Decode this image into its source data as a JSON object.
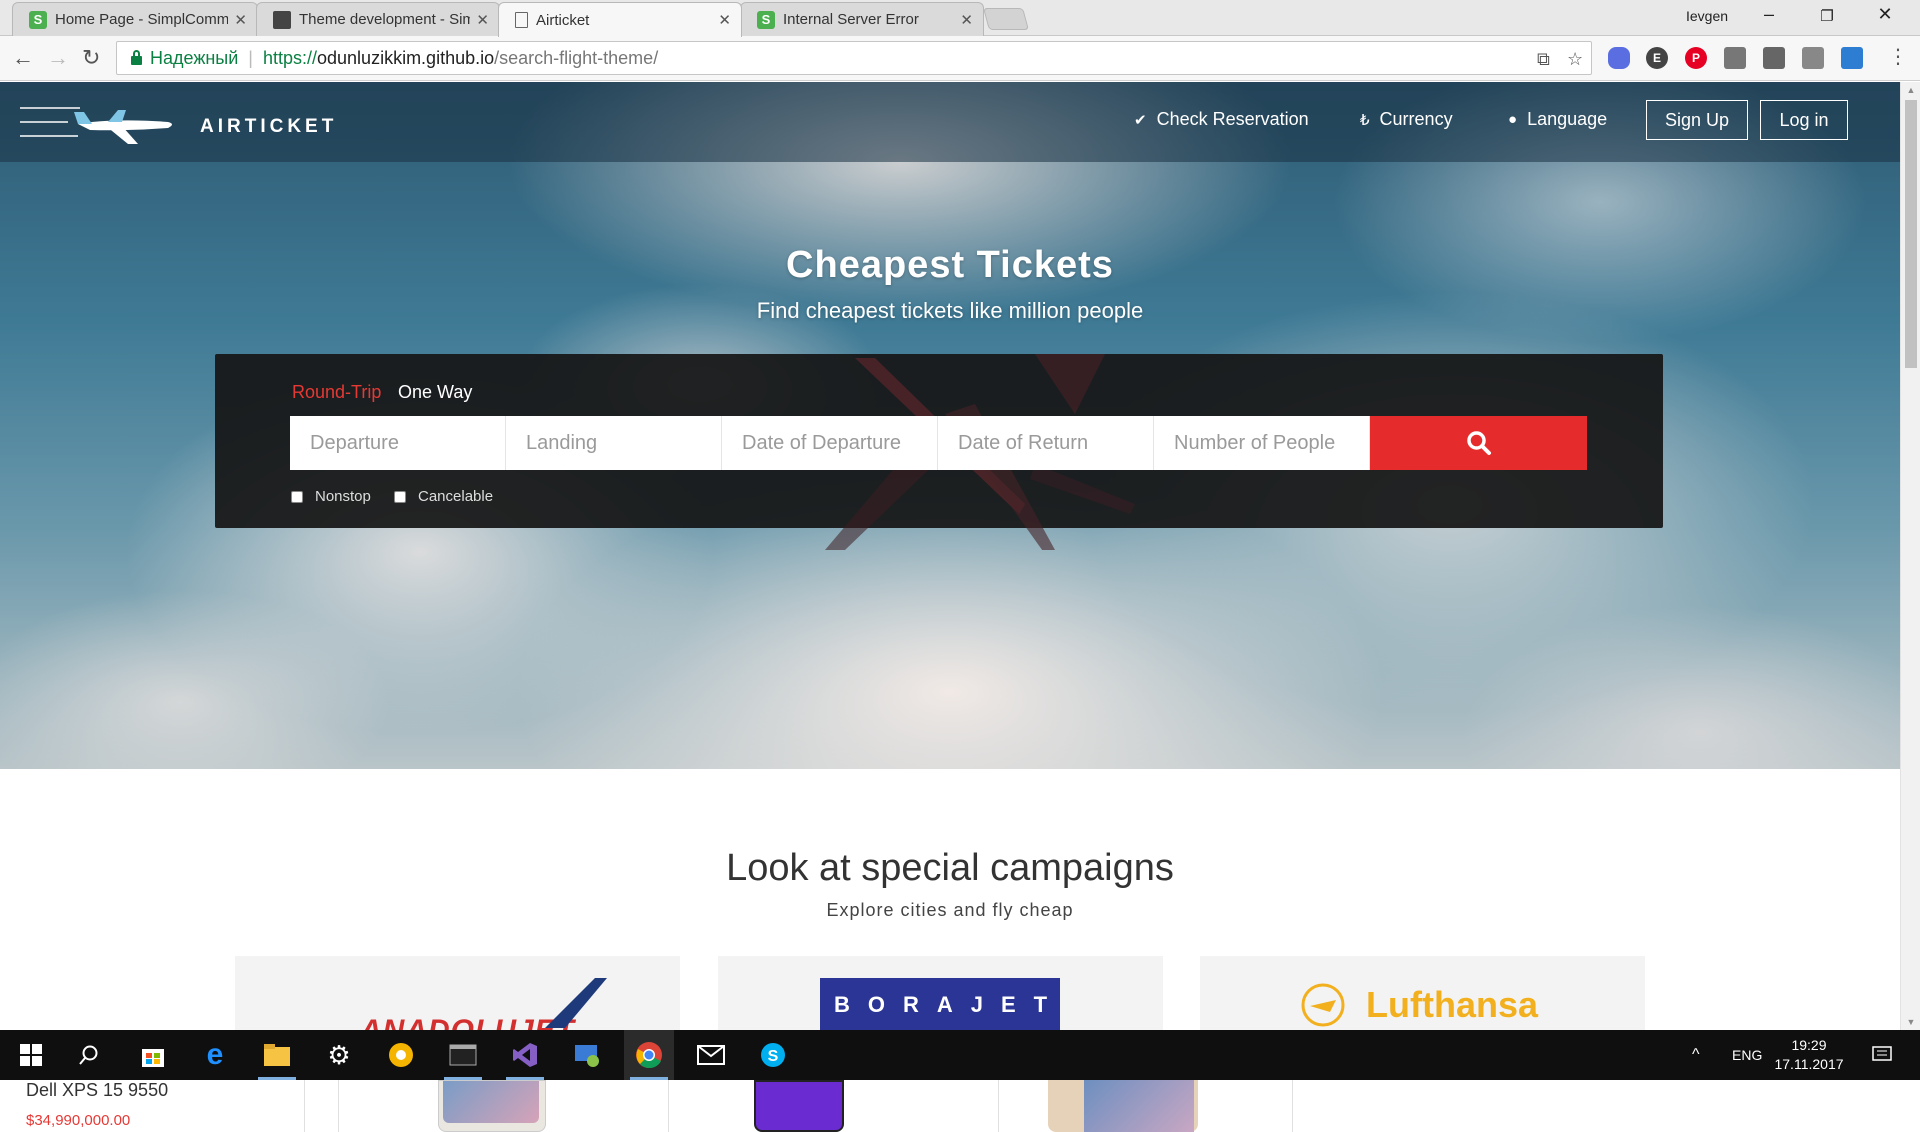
{
  "browser": {
    "tabs": [
      {
        "title": "Home Page - SimplCommerce",
        "favicon": "simplcommerce-icon"
      },
      {
        "title": "Theme development - SimplCommerce",
        "favicon": "book-icon"
      },
      {
        "title": "Airticket",
        "favicon": "page-icon"
      },
      {
        "title": "Internal Server Error",
        "favicon": "simplcommerce-icon"
      }
    ],
    "profile_name": "Ievgen",
    "secure_label": "Надежный",
    "url_scheme": "https://",
    "url_host": "odunluzikkim.github.io",
    "url_path": "/search-flight-theme/"
  },
  "site": {
    "brand": "AIRTICKET",
    "nav": {
      "check_reservation": "Check Reservation",
      "currency": "Currency",
      "language": "Language",
      "sign_up": "Sign Up",
      "log_in": "Log in"
    },
    "hero": {
      "title": "Cheapest Tickets",
      "subtitle": "Find cheapest tickets like million people"
    },
    "search": {
      "trip_round": "Round-Trip",
      "trip_one_way": "One Way",
      "placeholders": {
        "departure": "Departure",
        "landing": "Landing",
        "date_departure": "Date of Departure",
        "date_return": "Date of Return",
        "people": "Number of People"
      },
      "options": {
        "nonstop": "Nonstop",
        "cancelable": "Cancelable"
      }
    },
    "campaigns": {
      "title": "Look at special campaigns",
      "subtitle": "Explore cities and fly cheap",
      "airlines": [
        "ANADOLUJET",
        "BORAJET",
        "Lufthansa"
      ]
    }
  },
  "taskbar": {
    "language": "ENG",
    "time": "19:29",
    "date": "17.11.2017"
  },
  "second_window": {
    "product_title": "Dell XPS 15 9550",
    "product_price": "$34,990,000.00"
  },
  "colors": {
    "accent_red": "#e52b2b",
    "panel_dark": "#161616",
    "secure_green": "#0b8043"
  }
}
